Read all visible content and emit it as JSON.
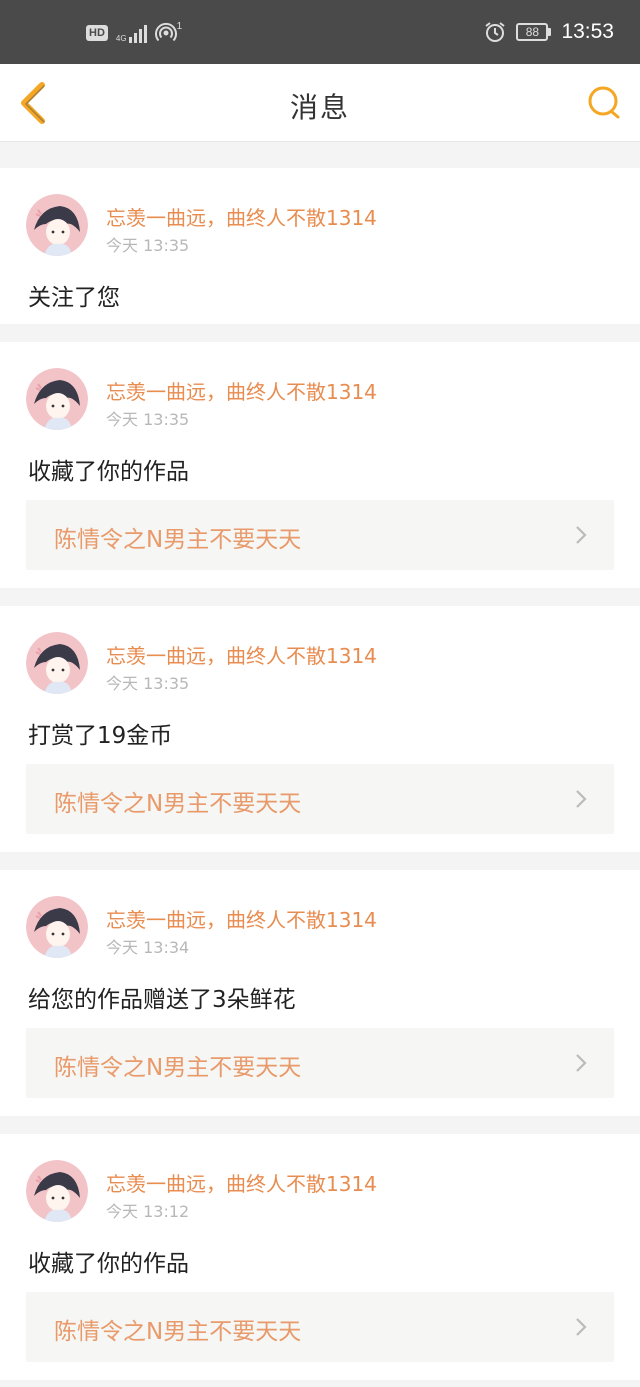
{
  "status_bar": {
    "hd": "HD",
    "network": "4G",
    "hotspot_count": "1",
    "battery": "88",
    "time": "13:53"
  },
  "header": {
    "title": "消息"
  },
  "messages": [
    {
      "user": "忘羡一曲远，曲终人不散1314",
      "time": "今天 13:35",
      "action": "关注了您",
      "work": null
    },
    {
      "user": "忘羡一曲远，曲终人不散1314",
      "time": "今天 13:35",
      "action": "收藏了你的作品",
      "work": "陈情令之N男主不要天天"
    },
    {
      "user": "忘羡一曲远，曲终人不散1314",
      "time": "今天 13:35",
      "action": "打赏了19金币",
      "work": "陈情令之N男主不要天天"
    },
    {
      "user": "忘羡一曲远，曲终人不散1314",
      "time": "今天 13:34",
      "action": "给您的作品赠送了3朵鲜花",
      "work": "陈情令之N男主不要天天"
    },
    {
      "user": "忘羡一曲远，曲终人不散1314",
      "time": "今天 13:12",
      "action": "收藏了你的作品",
      "work": "陈情令之N男主不要天天"
    }
  ],
  "colors": {
    "accent": "#f5a623",
    "username": "#e88c4f",
    "work_title": "#e89a6a"
  },
  "icons": {
    "back": "back-chevron-icon",
    "search": "search-icon",
    "forward": "chevron-right-icon"
  }
}
